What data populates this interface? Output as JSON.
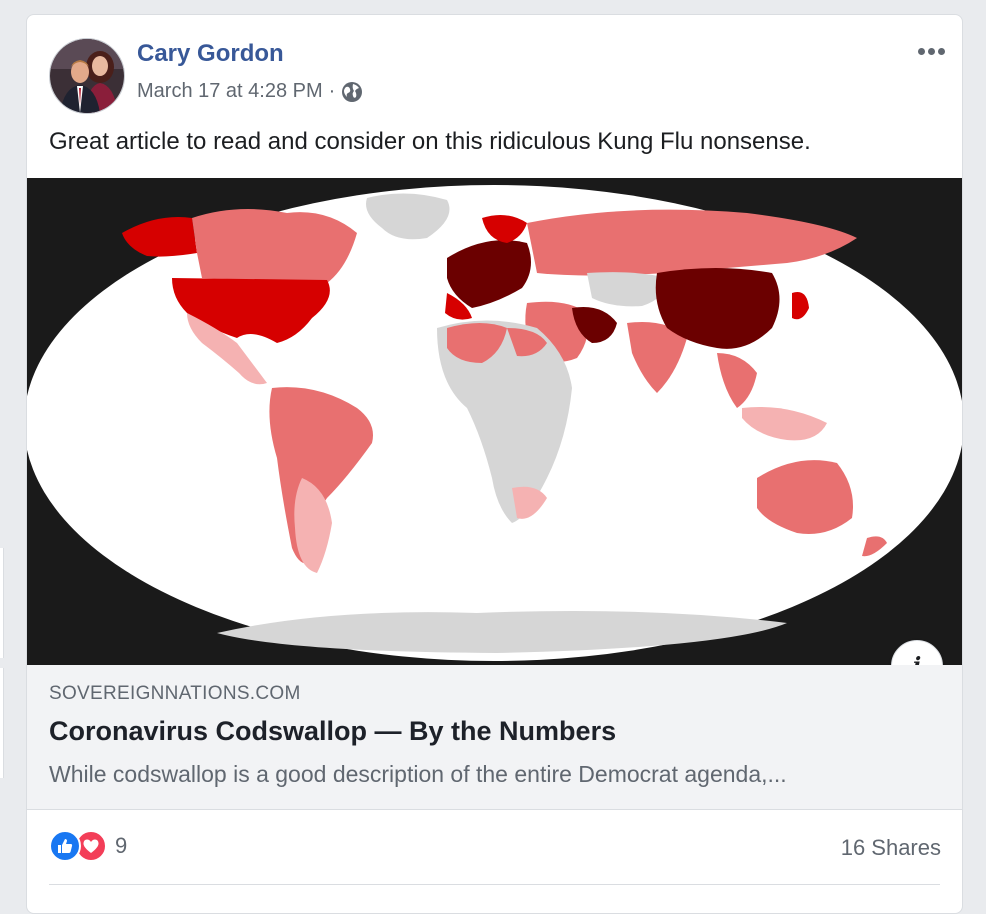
{
  "post": {
    "author": "Cary Gordon",
    "timestamp": "March 17 at 4:28 PM",
    "separator": "·",
    "text": "Great article to read and consider on this ridiculous Kung Flu nonsense."
  },
  "link": {
    "domain": "SOVEREIGNNATIONS.COM",
    "title": "Coronavirus Codswallop — By the Numbers",
    "description": "While codswallop is a good description of the entire Democrat agenda,...",
    "info_label": "i"
  },
  "engagement": {
    "reaction_count": "9",
    "shares": "16 Shares"
  },
  "colors": {
    "author_link": "#385898",
    "like": "#1877f2",
    "love": "#f33e58",
    "map_dark": "#6b0000",
    "map_red": "#d60000",
    "map_medium": "#e87070",
    "map_light": "#f5b2b2",
    "map_nodata": "#d6d6d6"
  },
  "icons": [
    "more-options-icon",
    "globe-icon",
    "info-icon",
    "like-icon",
    "love-icon"
  ]
}
